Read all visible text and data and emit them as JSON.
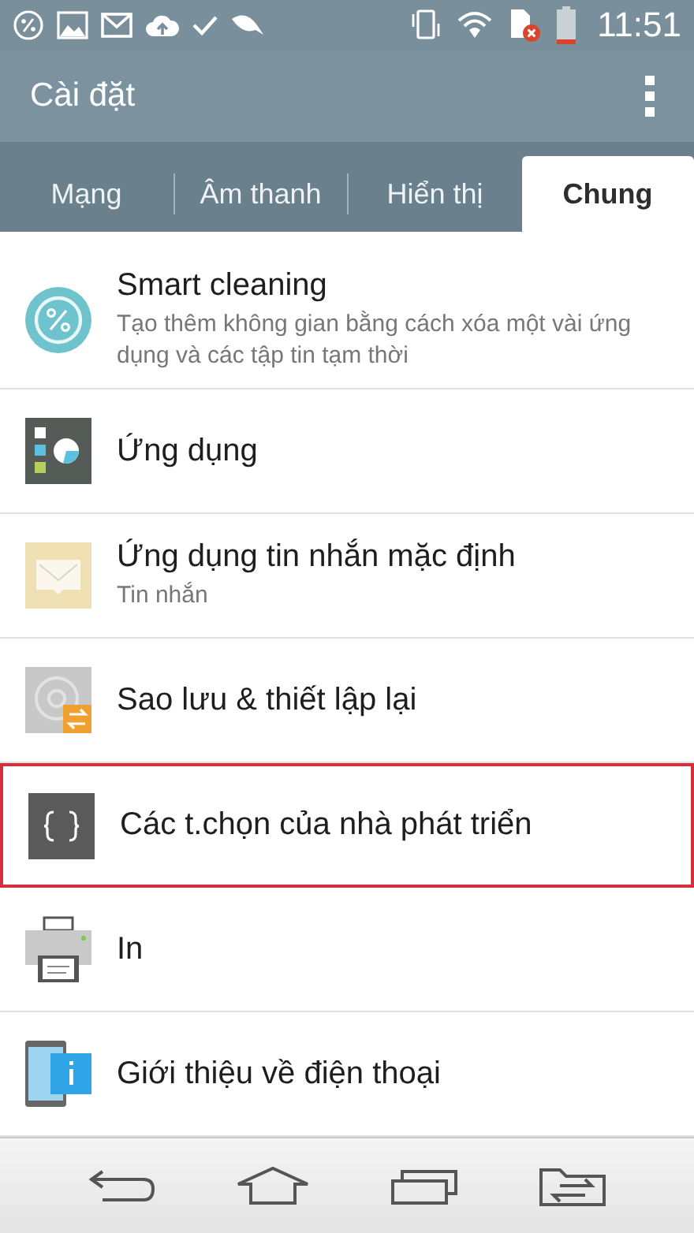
{
  "status_bar": {
    "time": "11:51"
  },
  "app_bar": {
    "title": "Cài đặt"
  },
  "tabs": [
    {
      "label": "Mạng",
      "selected": false
    },
    {
      "label": "Âm thanh",
      "selected": false
    },
    {
      "label": "Hiển thị",
      "selected": false
    },
    {
      "label": "Chung",
      "selected": true
    }
  ],
  "items": [
    {
      "title": "Smart cleaning",
      "subtitle": "Tạo thêm không gian bằng cách xóa một vài ứng dụng và các tập tin tạm thời",
      "highlighted": false
    },
    {
      "title": "Ứng dụng",
      "highlighted": false
    },
    {
      "title": "Ứng dụng tin nhắn mặc định",
      "subtitle": "Tin nhắn",
      "highlighted": false
    },
    {
      "title": "Sao lưu & thiết lập lại",
      "highlighted": false
    },
    {
      "title": "Các t.chọn của nhà phát triển",
      "highlighted": true
    },
    {
      "title": "In",
      "highlighted": false
    },
    {
      "title": "Giới thiệu về điện thoại",
      "highlighted": false
    }
  ]
}
